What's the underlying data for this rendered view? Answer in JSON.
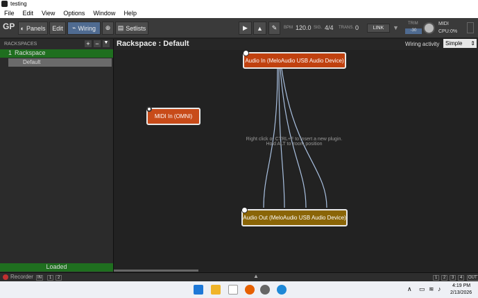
{
  "window": {
    "title": "testing"
  },
  "menu": [
    "File",
    "Edit",
    "View",
    "Options",
    "Window",
    "Help"
  ],
  "toolbar": {
    "panels": "Panels",
    "edit": "Edit",
    "wiring": "Wiring",
    "setlists": "Setlists",
    "bpm_label": "BPM",
    "bpm": "120.0",
    "sig_label": "SIG.",
    "sig": "4/4",
    "trans_label": "TRANS.",
    "trans": "0",
    "link": "LINK",
    "trim": "TRIM",
    "trim_value": "-30",
    "midi": "MIDI",
    "cpu": "CPU:",
    "cpu_value": "0%"
  },
  "sidebar": {
    "header": "RACKSPACES",
    "rackspace_num": "1",
    "rackspace_name": "Rackspace",
    "variation": "Default",
    "status": "Loaded"
  },
  "main": {
    "title": "Rackspace : Default",
    "wiring_activity": "Wiring activity",
    "wiring_mode": "Simple",
    "hint1": "Right click or CTRL+F to insert a new plugin.",
    "hint2": "Hold ALT to zoom position"
  },
  "nodes": {
    "audio_in": "Audio In (MeloAudio USB Audio Device)",
    "midi_in": "MIDI In (OMNI)",
    "audio_out": "Audio Out (MeloAudio USB Audio Device)"
  },
  "statusbar": {
    "recorder": "Recorder",
    "in": "IN",
    "in1": "1",
    "in2": "2",
    "outs": [
      "1",
      "2",
      "3",
      "4"
    ],
    "out": "OUT"
  },
  "taskbar": {
    "time": "4:19 PM",
    "date": "2/13/2026"
  },
  "colors": {
    "accent": "#4f6b91",
    "audio_node": "#c0410f",
    "midi_node": "#c84b19",
    "out_node": "#8a6507",
    "selected": "#1f6f1f"
  }
}
